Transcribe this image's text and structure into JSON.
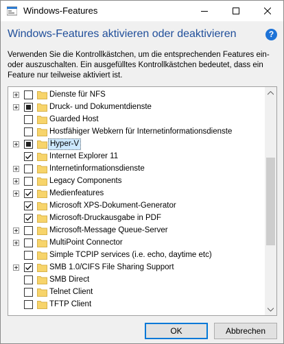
{
  "window": {
    "title": "Windows-Features"
  },
  "header": {
    "heading": "Windows-Features aktivieren oder deaktivieren",
    "help": "?",
    "description": "Verwenden Sie die Kontrollkästchen, um die entsprechenden Features ein- oder auszuschalten. Ein ausgefülltes Kontrollkästchen bedeutet, dass ein Feature nur teilweise aktiviert ist."
  },
  "features": [
    {
      "label": "Dienste für NFS",
      "expandable": true,
      "state": "unchecked"
    },
    {
      "label": "Druck- und Dokumentdienste",
      "expandable": true,
      "state": "partial"
    },
    {
      "label": "Guarded Host",
      "expandable": false,
      "state": "unchecked"
    },
    {
      "label": "Hostfähiger Webkern für Internetinformationsdienste",
      "expandable": false,
      "state": "unchecked"
    },
    {
      "label": "Hyper-V",
      "expandable": true,
      "state": "partial",
      "selected": true
    },
    {
      "label": "Internet Explorer 11",
      "expandable": false,
      "state": "checked"
    },
    {
      "label": "Internetinformationsdienste",
      "expandable": true,
      "state": "unchecked"
    },
    {
      "label": "Legacy Components",
      "expandable": true,
      "state": "unchecked"
    },
    {
      "label": "Medienfeatures",
      "expandable": true,
      "state": "checked"
    },
    {
      "label": "Microsoft XPS-Dokument-Generator",
      "expandable": false,
      "state": "checked"
    },
    {
      "label": "Microsoft-Druckausgabe in PDF",
      "expandable": false,
      "state": "checked"
    },
    {
      "label": "Microsoft-Message Queue-Server",
      "expandable": true,
      "state": "unchecked"
    },
    {
      "label": "MultiPoint Connector",
      "expandable": true,
      "state": "unchecked"
    },
    {
      "label": "Simple TCPIP services (i.e. echo, daytime etc)",
      "expandable": false,
      "state": "unchecked"
    },
    {
      "label": "SMB 1.0/CIFS File Sharing Support",
      "expandable": true,
      "state": "checked"
    },
    {
      "label": "SMB Direct",
      "expandable": false,
      "state": "unchecked"
    },
    {
      "label": "Telnet Client",
      "expandable": false,
      "state": "unchecked"
    },
    {
      "label": "TFTP Client",
      "expandable": false,
      "state": "unchecked"
    }
  ],
  "buttons": {
    "ok": "OK",
    "cancel": "Abbrechen"
  },
  "colors": {
    "heading": "#1f4e9a",
    "selection": "#cce8ff",
    "folder": "#f7d46b",
    "help": "#1e73d7"
  }
}
